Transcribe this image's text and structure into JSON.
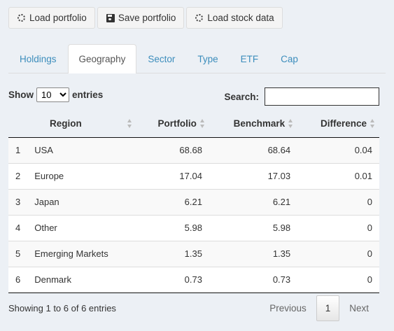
{
  "toolbar": {
    "load_portfolio": "Load portfolio",
    "save_portfolio": "Save portfolio",
    "load_stock_data": "Load stock data"
  },
  "tabs": [
    {
      "label": "Holdings",
      "active": false
    },
    {
      "label": "Geography",
      "active": true
    },
    {
      "label": "Sector",
      "active": false
    },
    {
      "label": "Type",
      "active": false
    },
    {
      "label": "ETF",
      "active": false
    },
    {
      "label": "Cap",
      "active": false
    }
  ],
  "length": {
    "show": "Show",
    "value": "10",
    "entries": "entries"
  },
  "search": {
    "label": "Search:",
    "value": ""
  },
  "table": {
    "headers": {
      "region": "Region",
      "portfolio": "Portfolio",
      "benchmark": "Benchmark",
      "difference": "Difference"
    },
    "rows": [
      {
        "idx": "1",
        "region": "USA",
        "portfolio": "68.68",
        "benchmark": "68.64",
        "difference": "0.04"
      },
      {
        "idx": "2",
        "region": "Europe",
        "portfolio": "17.04",
        "benchmark": "17.03",
        "difference": "0.01"
      },
      {
        "idx": "3",
        "region": "Japan",
        "portfolio": "6.21",
        "benchmark": "6.21",
        "difference": "0"
      },
      {
        "idx": "4",
        "region": "Other",
        "portfolio": "5.98",
        "benchmark": "5.98",
        "difference": "0"
      },
      {
        "idx": "5",
        "region": "Emerging Markets",
        "portfolio": "1.35",
        "benchmark": "1.35",
        "difference": "0"
      },
      {
        "idx": "6",
        "region": "Denmark",
        "portfolio": "0.73",
        "benchmark": "0.73",
        "difference": "0"
      }
    ]
  },
  "footer": {
    "info": "Showing 1 to 6 of 6 entries",
    "previous": "Previous",
    "page": "1",
    "next": "Next"
  }
}
